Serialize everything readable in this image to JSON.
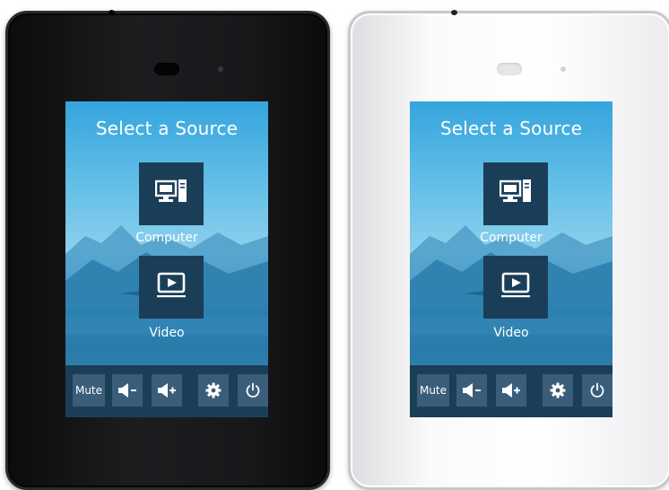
{
  "panels": [
    {
      "finish": "black",
      "screen": {
        "title": "Select a Source",
        "sources": [
          {
            "label": "Computer",
            "icon": "computer-icon"
          },
          {
            "label": "Video",
            "icon": "video-play-icon"
          }
        ],
        "controls": [
          {
            "label": "Mute"
          },
          {
            "icon": "volume-down-icon"
          },
          {
            "icon": "volume-up-icon"
          },
          {
            "icon": "gear-icon"
          },
          {
            "icon": "power-icon"
          }
        ]
      }
    },
    {
      "finish": "white",
      "screen": {
        "title": "Select a Source",
        "sources": [
          {
            "label": "Computer",
            "icon": "computer-icon"
          },
          {
            "label": "Video",
            "icon": "video-play-icon"
          }
        ],
        "controls": [
          {
            "label": "Mute"
          },
          {
            "icon": "volume-down-icon"
          },
          {
            "icon": "volume-up-icon"
          },
          {
            "icon": "gear-icon"
          },
          {
            "icon": "power-icon"
          }
        ]
      }
    }
  ],
  "colors": {
    "tile": "#1b3e58",
    "control_bar": "#18344a",
    "control_button": "#3a5e7a",
    "sky": "#35a5dd",
    "text": "#ffffff"
  }
}
